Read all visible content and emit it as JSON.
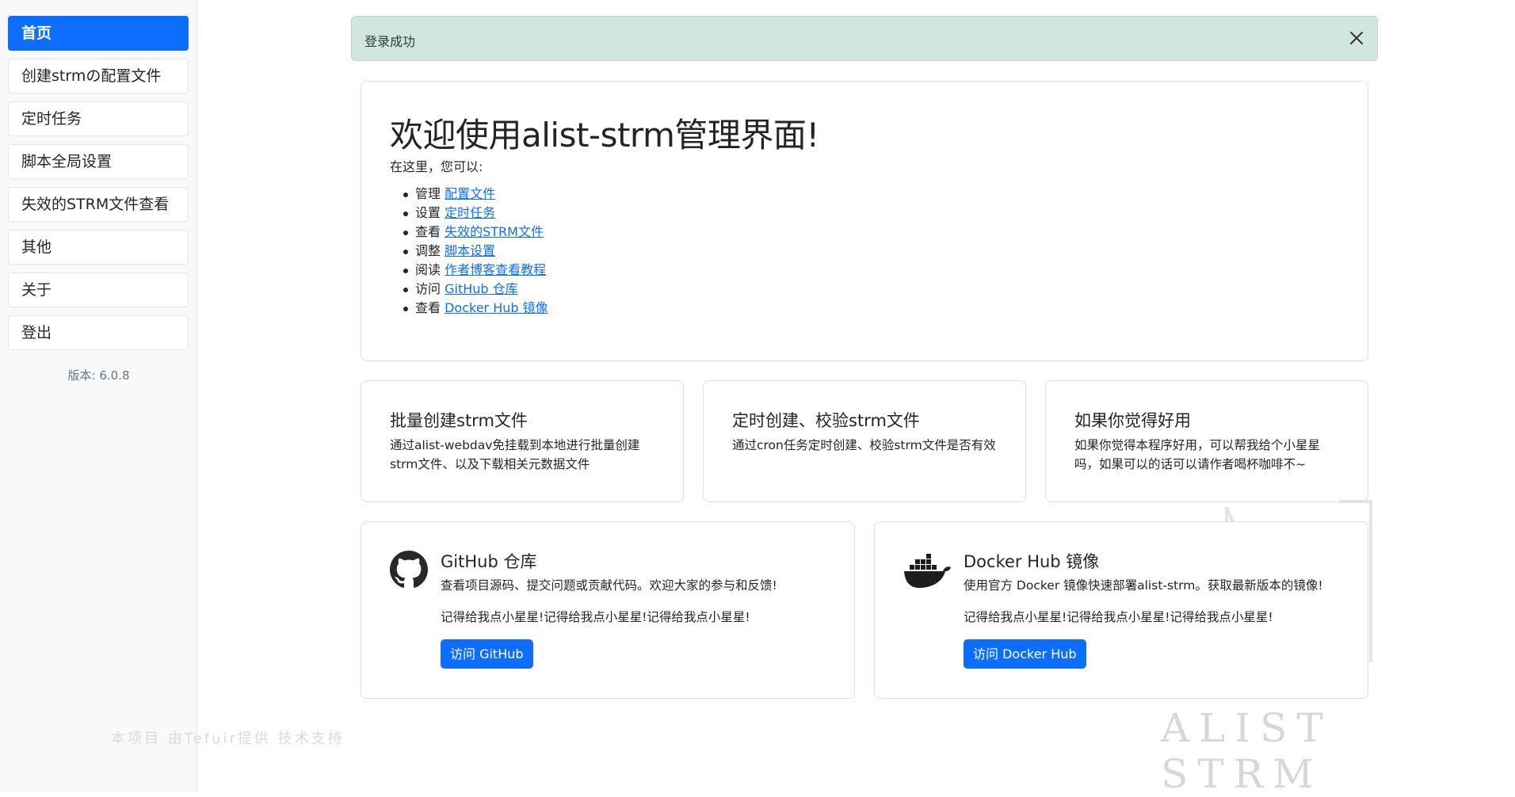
{
  "sidebar": {
    "items": [
      {
        "label": "首页",
        "active": true
      },
      {
        "label": "创建strmの配置文件"
      },
      {
        "label": "定时任务"
      },
      {
        "label": "脚本全局设置"
      },
      {
        "label": "失效的STRM文件查看"
      },
      {
        "label": "其他"
      },
      {
        "label": "关于"
      },
      {
        "label": "登出"
      }
    ],
    "version": "版本: 6.0.8",
    "credit": "本项目 由Tefuir提供 技术支持"
  },
  "alert": {
    "text": "登录成功",
    "close_icon": "close-icon"
  },
  "welcome": {
    "title": "欢迎使用alist-strm管理界面!",
    "intro": "在这里，您可以:",
    "items": [
      {
        "verb": "管理",
        "link": "配置文件"
      },
      {
        "verb": "设置",
        "link": "定时任务"
      },
      {
        "verb": "查看",
        "link": "失效的STRM文件"
      },
      {
        "verb": "调整",
        "link": "脚本设置"
      },
      {
        "verb": "阅读",
        "link": "作者博客查看教程"
      },
      {
        "verb": "访问",
        "link": "GitHub 仓库"
      },
      {
        "verb": "查看",
        "link": "Docker Hub 镜像"
      }
    ]
  },
  "features": [
    {
      "title": "批量创建strm文件",
      "desc": "通过alist-webdav免挂载到本地进行批量创建strm文件、以及下载相关元数据文件"
    },
    {
      "title": "定时创建、校验strm文件",
      "desc": "通过cron任务定时创建、校验strm文件是否有效"
    },
    {
      "title": "如果你觉得好用",
      "desc": "如果你觉得本程序好用，可以帮我给个小星星吗，如果可以的话可以请作者喝杯咖啡不~"
    }
  ],
  "github": {
    "icon": "github-icon",
    "title": "GitHub 仓库",
    "desc": "查看项目源码、提交问题或贡献代码。欢迎大家的参与和反馈!",
    "star_note": "记得给我点小星星!记得给我点小星星!记得给我点小星星!",
    "button": "访问 GitHub"
  },
  "docker": {
    "icon": "docker-icon",
    "title": "Docker Hub 镜像",
    "desc": "使用官方 Docker 镜像快速部署alist-strm。获取最新版本的镜像!",
    "star_note": "记得给我点小星星!记得给我点小星星!记得给我点小星星!",
    "button": "访问 Docker Hub"
  },
  "watermark": {
    "text": "ALIST STRM"
  },
  "colors": {
    "primary": "#0d6efd",
    "alert_bg": "#d1e7dd",
    "sidebar_bg": "#f8f9fa"
  }
}
